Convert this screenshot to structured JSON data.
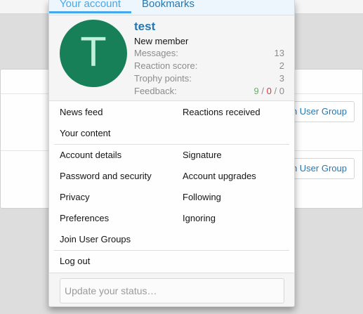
{
  "background": {
    "buttons": [
      "n User Group",
      "n User Group"
    ]
  },
  "menu": {
    "tabs": [
      {
        "label": "Your account"
      },
      {
        "label": "Bookmarks"
      }
    ],
    "avatar_letter": "T",
    "avatar_color": "#178059",
    "username": "test",
    "user_title": "New member",
    "stats": [
      {
        "label": "Messages:",
        "value": "13"
      },
      {
        "label": "Reaction score:",
        "value": "2"
      },
      {
        "label": "Trophy points:",
        "value": "3"
      }
    ],
    "feedback": {
      "label": "Feedback:",
      "positive": "9",
      "negative": "0",
      "neutral": "0",
      "separator": "/"
    },
    "links_group1": [
      "News feed",
      "Reactions received",
      "Your content"
    ],
    "links_group2": [
      "Account details",
      "Signature",
      "Password and security",
      "Account upgrades",
      "Privacy",
      "Following",
      "Preferences",
      "Ignoring",
      "Join User Groups"
    ],
    "logout": "Log out",
    "status_placeholder": "Update your status…"
  }
}
